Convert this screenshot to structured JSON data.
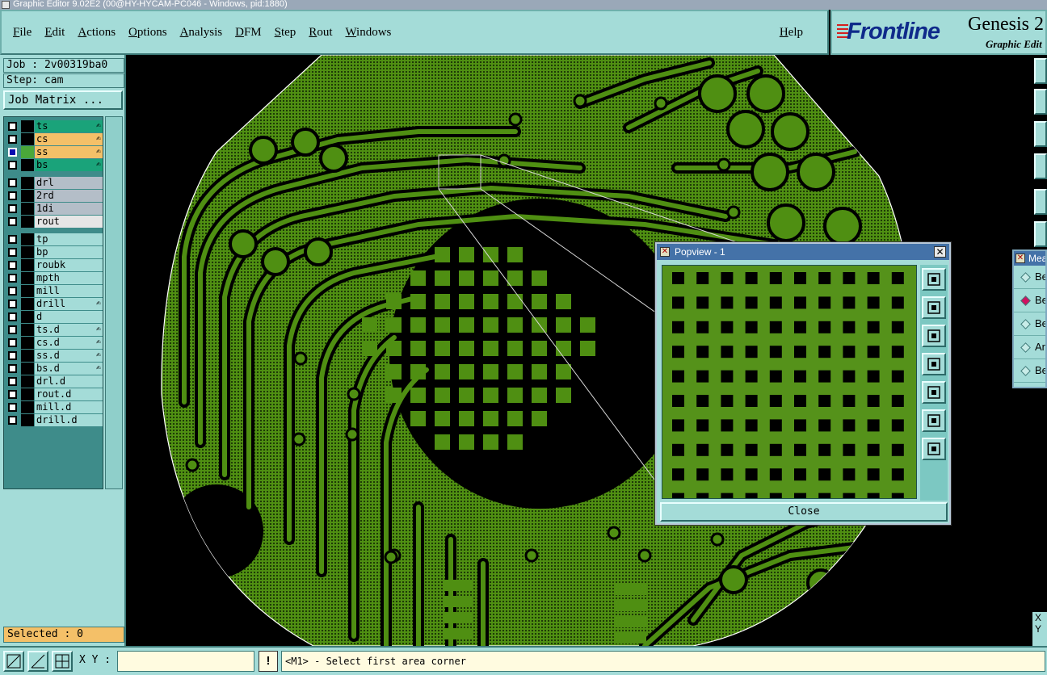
{
  "window": {
    "title": "Graphic Editor 9.02E2 (00@HY-HYCAM-PC046 - Windows, pid:1880)"
  },
  "menu": {
    "items": [
      "File",
      "Edit",
      "Actions",
      "Options",
      "Analysis",
      "DFM",
      "Step",
      "Rout",
      "Windows"
    ],
    "help": "Help"
  },
  "logo": {
    "brand": "Frontline",
    "product": "Genesis 2",
    "subtitle": "Graphic Edit"
  },
  "job": {
    "job_label": "Job : 2v00319ba0",
    "step_label": "Step: cam",
    "matrix_button": "Job Matrix ..."
  },
  "layers": [
    {
      "name": "ts",
      "color": "#1aa37a",
      "checked": false,
      "selected": false,
      "affected": true
    },
    {
      "name": "cs",
      "color": "#f4c068",
      "checked": false,
      "selected": false,
      "affected": true
    },
    {
      "name": "ss",
      "color": "#f4c068",
      "checked": true,
      "selected": true,
      "affected": true
    },
    {
      "name": "bs",
      "color": "#1aa37a",
      "checked": false,
      "selected": false,
      "affected": true
    },
    {
      "name": "drl",
      "color": "#b4bec8",
      "checked": false,
      "selected": false,
      "affected": false
    },
    {
      "name": "2rd",
      "color": "#b4bec8",
      "checked": false,
      "selected": false,
      "affected": false
    },
    {
      "name": "1di",
      "color": "#b4bec8",
      "checked": false,
      "selected": false,
      "affected": false
    },
    {
      "name": "rout",
      "color": "#e6e6e6",
      "checked": false,
      "selected": false,
      "affected": false
    },
    {
      "name": "tp",
      "color": "#a4dcd8",
      "checked": false,
      "selected": false,
      "affected": false
    },
    {
      "name": "bp",
      "color": "#a4dcd8",
      "checked": false,
      "selected": false,
      "affected": false
    },
    {
      "name": "roubk",
      "color": "#a4dcd8",
      "checked": false,
      "selected": false,
      "affected": false
    },
    {
      "name": "mpth",
      "color": "#a4dcd8",
      "checked": false,
      "selected": false,
      "affected": false
    },
    {
      "name": "mill",
      "color": "#a4dcd8",
      "checked": false,
      "selected": false,
      "affected": false
    },
    {
      "name": "drill",
      "color": "#a4dcd8",
      "checked": false,
      "selected": false,
      "affected": true
    },
    {
      "name": "d",
      "color": "#a4dcd8",
      "checked": false,
      "selected": false,
      "affected": false
    },
    {
      "name": "ts.d",
      "color": "#a4dcd8",
      "checked": false,
      "selected": false,
      "affected": true
    },
    {
      "name": "cs.d",
      "color": "#a4dcd8",
      "checked": false,
      "selected": false,
      "affected": true
    },
    {
      "name": "ss.d",
      "color": "#a4dcd8",
      "checked": false,
      "selected": false,
      "affected": true
    },
    {
      "name": "bs.d",
      "color": "#a4dcd8",
      "checked": false,
      "selected": false,
      "affected": true
    },
    {
      "name": "drl.d",
      "color": "#a4dcd8",
      "checked": false,
      "selected": false,
      "affected": false
    },
    {
      "name": "rout.d",
      "color": "#a4dcd8",
      "checked": false,
      "selected": false,
      "affected": false
    },
    {
      "name": "mill.d",
      "color": "#a4dcd8",
      "checked": false,
      "selected": false,
      "affected": false
    },
    {
      "name": "drill.d",
      "color": "#a4dcd8",
      "checked": false,
      "selected": false,
      "affected": false
    }
  ],
  "layer_affected_glyph": "✍",
  "selected_label": "Selected : 0",
  "popview": {
    "title": "Popview - 1",
    "close_label": "Close",
    "close_x": "✕",
    "tools": [
      "fit-icon",
      "pan-up-icon",
      "pan-down-icon",
      "pan-left-icon",
      "pan-right-icon",
      "zoom-in-icon",
      "zoom-out-icon"
    ]
  },
  "measure": {
    "title": "Mea",
    "items": [
      {
        "label": "Be",
        "on": false
      },
      {
        "label": "Be",
        "on": true
      },
      {
        "label": "Be",
        "on": false
      },
      {
        "label": "An",
        "on": false
      },
      {
        "label": "Be",
        "on": false
      }
    ]
  },
  "xy_strip": {
    "x": "X",
    "y": "Y"
  },
  "bottom": {
    "xy_label": "X Y :",
    "xy_value": "",
    "bang": "!",
    "status": "<M1> - Select first area corner"
  },
  "colors": {
    "copper": "#4f8f12",
    "background": "#000000",
    "ui_teal": "#a4dcd8"
  }
}
